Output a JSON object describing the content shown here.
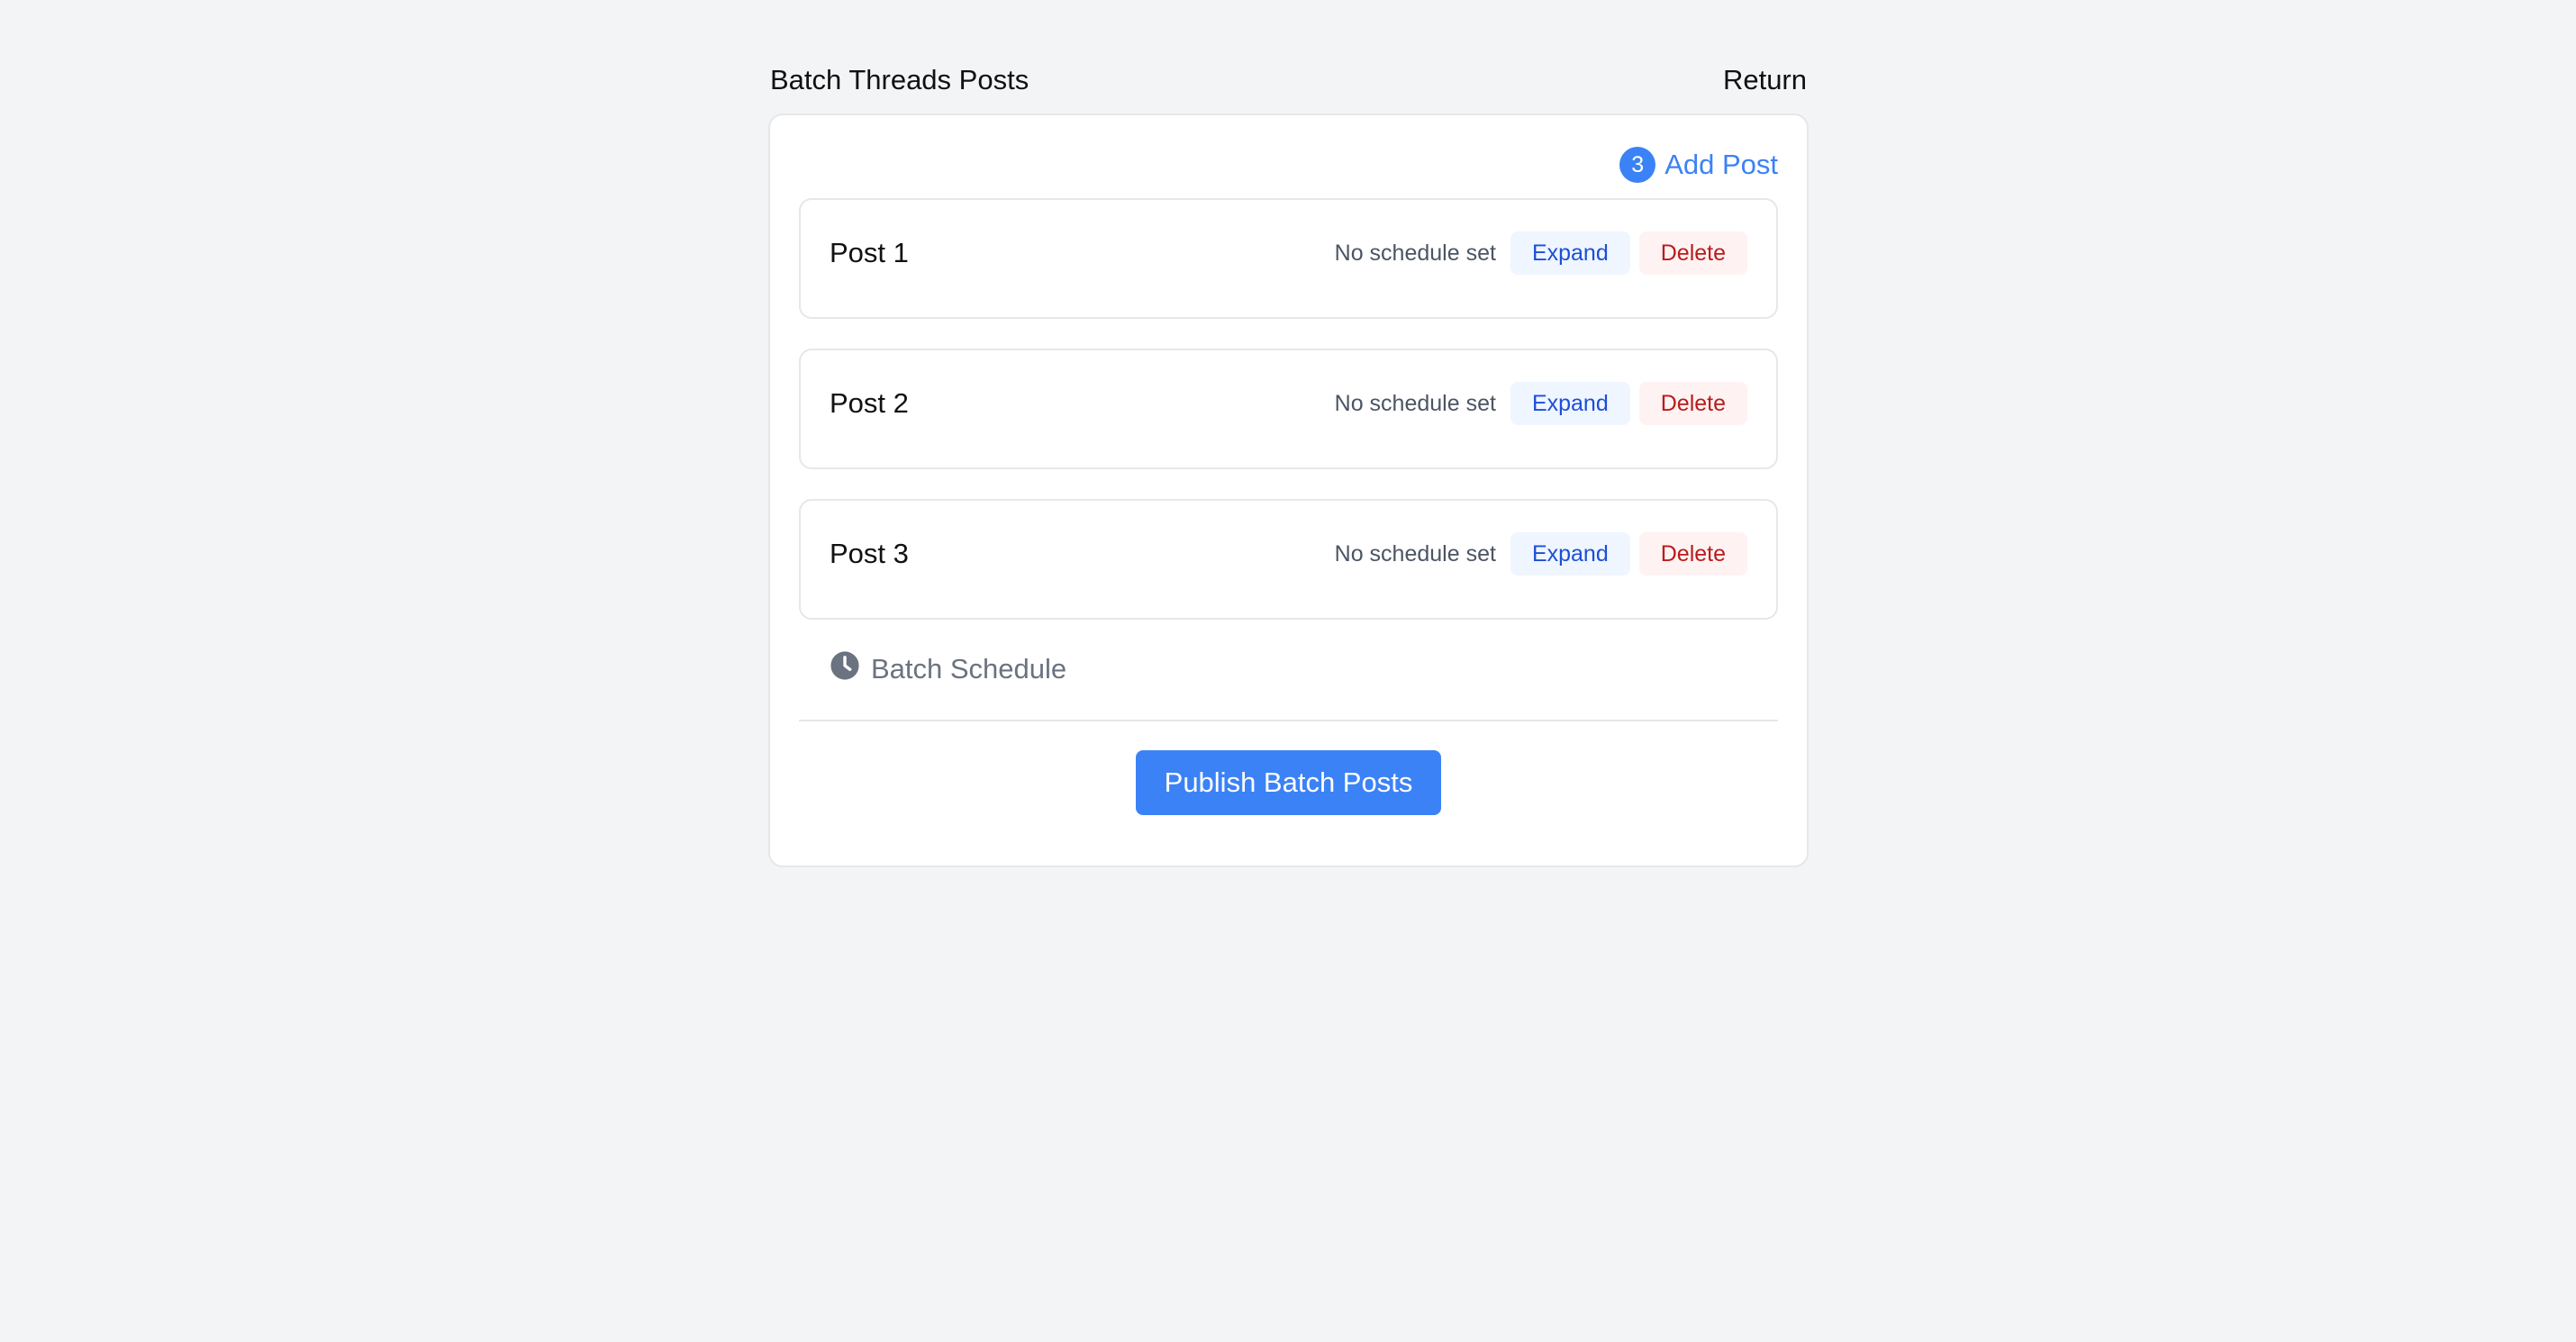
{
  "header": {
    "title": "Batch Threads Posts",
    "return_label": "Return"
  },
  "toolbar": {
    "post_count": "3",
    "add_post_label": "Add Post"
  },
  "posts": [
    {
      "title": "Post 1",
      "schedule": "No schedule set",
      "expand_label": "Expand",
      "delete_label": "Delete"
    },
    {
      "title": "Post 2",
      "schedule": "No schedule set",
      "expand_label": "Expand",
      "delete_label": "Delete"
    },
    {
      "title": "Post 3",
      "schedule": "No schedule set",
      "expand_label": "Expand",
      "delete_label": "Delete"
    }
  ],
  "batch_schedule": {
    "label": "Batch Schedule",
    "icon": "clock-icon"
  },
  "footer": {
    "publish_label": "Publish Batch Posts"
  },
  "colors": {
    "accent": "#3b82f6",
    "danger": "#b91c1c",
    "background": "#f3f4f6"
  }
}
